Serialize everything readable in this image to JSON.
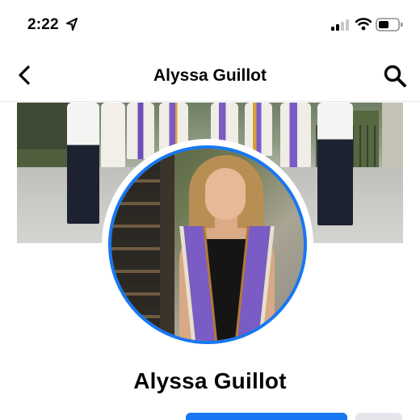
{
  "status_bar": {
    "time": "2:22",
    "icons": [
      "location-arrow-icon",
      "cellular-signal-icon",
      "wifi-icon",
      "battery-icon"
    ]
  },
  "nav": {
    "title": "Alyssa Guillot",
    "icons": [
      "back-chevron-icon",
      "search-icon"
    ]
  },
  "profile": {
    "name": "Alyssa Guillot"
  },
  "colors": {
    "accent": "#1877f2",
    "text": "#050505",
    "divider": "#e4e6eb",
    "secondary_button": "#e4e6eb"
  }
}
